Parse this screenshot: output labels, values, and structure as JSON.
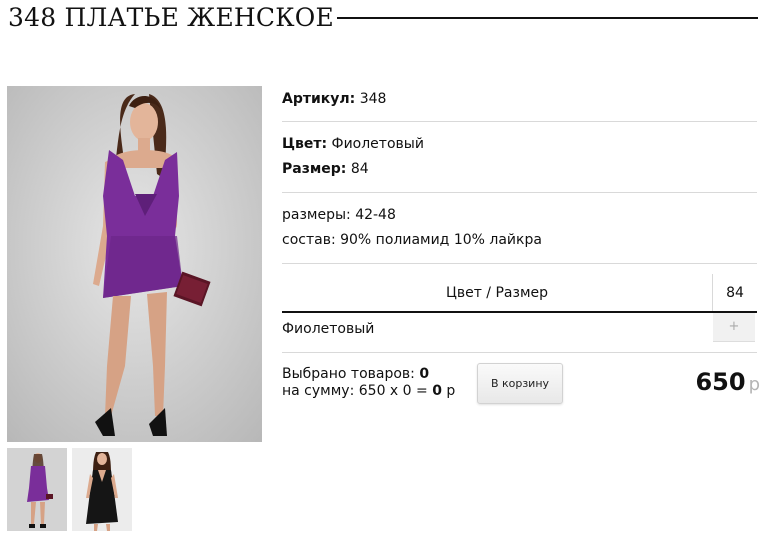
{
  "product": {
    "title": "348 ПЛАТЬЕ ЖЕНСКОЕ",
    "article_label": "Артикул:",
    "article_value": "348",
    "color_label": "Цвет:",
    "color_value": "Фиолетовый",
    "size_label": "Размер:",
    "size_value": "84",
    "sizes_text": "размеры: 42-48",
    "composition_text": "состав: 90% полиамид 10% лайкра"
  },
  "variants_table": {
    "header_label": "Цвет / Размер",
    "size_column": "84",
    "row_color": "Фиолетовый",
    "qty_button": "+"
  },
  "summary": {
    "selected_label": "Выбрано товаров:",
    "selected_count": "0",
    "sum_label": "на сумму:",
    "sum_formula": "650 x 0 =",
    "sum_value": "0",
    "sum_currency": "р"
  },
  "cart_button_label": "В корзину",
  "price": {
    "value": "650",
    "currency": "р"
  },
  "colors": {
    "dress_purple": "#7a2e9a",
    "dress_black": "#151515",
    "photo_bg": "#c9c9c9",
    "rule": "#111111",
    "separator": "#d9d9d9"
  },
  "icons": {
    "qty_plus": "plus-icon"
  }
}
